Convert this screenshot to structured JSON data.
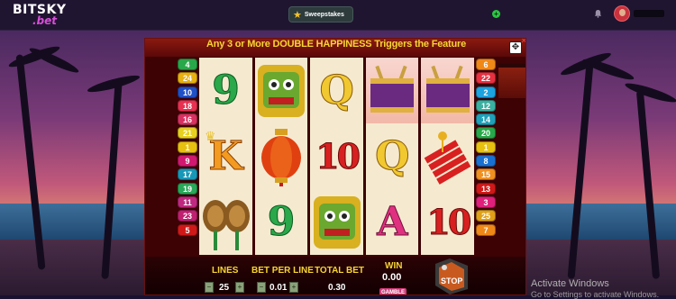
{
  "site": {
    "logo_main": "BITSKY",
    "logo_sub": ".bet",
    "sweepstakes_label": "Sweepstakes",
    "add_label": "+"
  },
  "game": {
    "banner": "Any 3 or More DOUBLE HAPPINESS Triggers the Feature",
    "left_lines": [
      "4",
      "24",
      "10",
      "18",
      "16",
      "21",
      "1",
      "9",
      "17",
      "19",
      "11",
      "23",
      "5"
    ],
    "right_lines": [
      "6",
      "22",
      "2",
      "12",
      "14",
      "20",
      "1",
      "8",
      "15",
      "13",
      "3",
      "25",
      "7"
    ],
    "line_colors": {
      "1": "#e8c010",
      "2": "#1ca3e0",
      "3": "#e0207a",
      "4": "#28a84a",
      "5": "#d01818",
      "6": "#f08818",
      "7": "#f08818",
      "8": "#1a70d0",
      "9": "#d01870",
      "10": "#2050c8",
      "11": "#c02880",
      "12": "#3ab0a0",
      "13": "#d01818",
      "14": "#20a0b8",
      "15": "#f09020",
      "16": "#d83060",
      "17": "#1898b8",
      "18": "#e83050",
      "19": "#28a858",
      "20": "#28a84a",
      "21": "#e8d020",
      "22": "#e83040",
      "23": "#c02070",
      "24": "#e8b010",
      "25": "#e0a018"
    },
    "reels": [
      [
        "nine",
        "cymbals-king",
        "cymbals"
      ],
      [
        "lion",
        "lantern",
        "nine"
      ],
      [
        "q",
        "ten",
        "lion"
      ],
      [
        "drum",
        "q",
        "a"
      ],
      [
        "drum",
        "firecrackers",
        "ten"
      ]
    ],
    "symbols": {
      "nine": "9",
      "q": "Q",
      "k": "K",
      "ten": "10",
      "a": "A"
    },
    "controls": {
      "lines_label": "LINES",
      "lines_value": "25",
      "bet_per_line_label": "BET PER LINE",
      "bet_per_line_value": "0.01",
      "total_bet_label": "TOTAL BET",
      "total_bet_value": "0.30",
      "win_label": "WIN",
      "win_value": "0.00",
      "gamble_label": "GAMBLE",
      "stop_label": "STOP",
      "minus": "−",
      "plus": "+"
    }
  },
  "watermark": {
    "title": "Activate Windows",
    "subtitle": "Go to Settings to activate Windows."
  }
}
